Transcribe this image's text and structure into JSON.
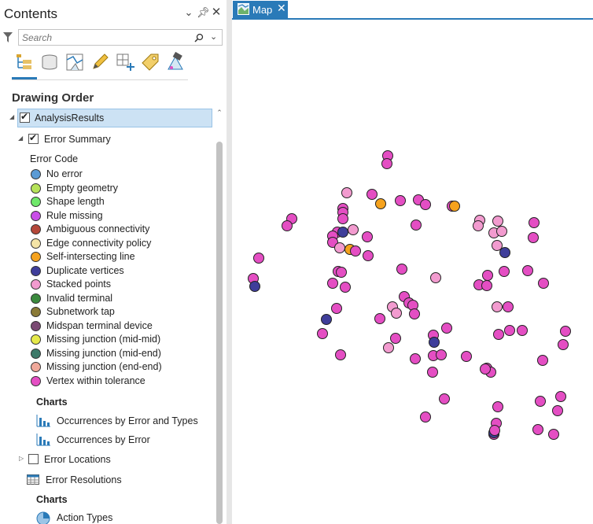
{
  "contents_pane": {
    "title": "Contents",
    "search": {
      "placeholder": "Search"
    },
    "section_title": "Drawing Order",
    "layers": {
      "group": "AnalysisResults",
      "error_summary": "Error Summary",
      "legend_heading": "Error Code",
      "legend": [
        {
          "label": "No error",
          "color": "#5b9bd5"
        },
        {
          "label": "Empty geometry",
          "color": "#b6e35a"
        },
        {
          "label": "Shape length",
          "color": "#6fe86a"
        },
        {
          "label": "Rule missing",
          "color": "#c94ee8"
        },
        {
          "label": "Ambiguous connectivity",
          "color": "#b5483a"
        },
        {
          "label": "Edge connectivity policy",
          "color": "#f4e4a6"
        },
        {
          "label": "Self-intersecting line",
          "color": "#f5a21d"
        },
        {
          "label": "Duplicate vertices",
          "color": "#3f3e9a"
        },
        {
          "label": "Stacked points",
          "color": "#f29bcf"
        },
        {
          "label": "Invalid terminal",
          "color": "#3b8a3e"
        },
        {
          "label": "Subnetwork tap",
          "color": "#8a7a36"
        },
        {
          "label": "Midspan terminal device",
          "color": "#7a4a73"
        },
        {
          "label": "Missing junction (mid-mid)",
          "color": "#e6ea4a"
        },
        {
          "label": "Missing junction (mid-end)",
          "color": "#3e7a6a"
        },
        {
          "label": "Missing junction (end-end)",
          "color": "#f0a89a"
        },
        {
          "label": "Vertex within tolerance",
          "color": "#e44ec3"
        }
      ],
      "charts_heading": "Charts",
      "charts": [
        "Occurrences by Error and Types",
        "Occurrences by Error"
      ],
      "error_locations": "Error Locations",
      "error_resolutions": "Error Resolutions",
      "charts_heading_2": "Charts",
      "action_types": "Action Types"
    }
  },
  "map_view": {
    "tab_label": "Map",
    "accent_color": "#2a7ab8"
  }
}
